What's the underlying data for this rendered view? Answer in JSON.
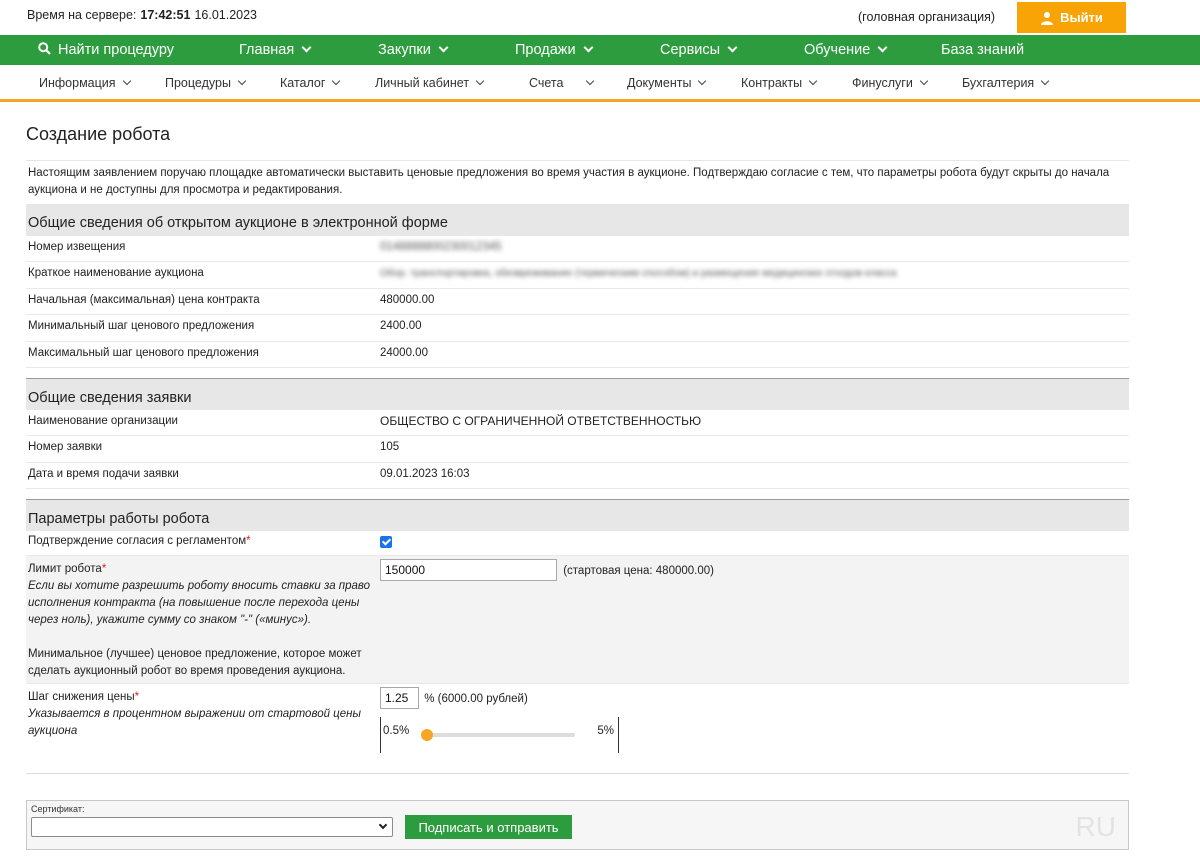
{
  "topbar": {
    "server_time_label": "Время на сервере:",
    "server_time": "17:42:51",
    "server_date": "16.01.2023",
    "org_note": "(головная организация)",
    "logout_label": "Выйти"
  },
  "colors": {
    "green": "#2d9c3f",
    "orange": "#f8a407",
    "accent_line": "#f5a623"
  },
  "main_nav": {
    "search_label": "Найти процедуру",
    "items": [
      {
        "label": "Главная",
        "dropdown": true
      },
      {
        "label": "Закупки",
        "dropdown": true
      },
      {
        "label": "Продажи",
        "dropdown": true
      },
      {
        "label": "Сервисы",
        "dropdown": true
      },
      {
        "label": "Обучение",
        "dropdown": true
      },
      {
        "label": "База знаний",
        "dropdown": false
      }
    ]
  },
  "sub_nav": {
    "items": [
      {
        "label": "Информация"
      },
      {
        "label": "Процедуры"
      },
      {
        "label": "Каталог"
      },
      {
        "label": "Личный кабинет"
      },
      {
        "label": "Счета"
      },
      {
        "label": "Документы"
      },
      {
        "label": "Контракты"
      },
      {
        "label": "Финуслуги"
      },
      {
        "label": "Бухгалтерия"
      }
    ]
  },
  "page": {
    "title": "Создание робота",
    "intro": "Настоящим заявлением поручаю площадке автоматически выставить ценовые предложения во время участия в аукционе. Подтверждаю согласие с тем, что параметры робота будут скрыты до начала аукциона и не доступны для просмотра и редактирования."
  },
  "auction": {
    "heading": "Общие сведения об открытом аукционе в электронной форме",
    "notice_label": "Номер извещения",
    "notice_value": "0148888800230012345",
    "short_name_label": "Краткое наименование аукциона",
    "short_name_value": "Обор. транспортировка, обезвреживание (термическим способом) и размещение медицинских отходов класса",
    "start_price_label": "Начальная (максимальная) цена контракта",
    "start_price_value": "480000.00",
    "min_step_label": "Минимальный шаг ценового предложения",
    "min_step_value": "2400.00",
    "max_step_label": "Максимальный шаг ценового предложения",
    "max_step_value": "24000.00"
  },
  "application": {
    "heading": "Общие сведения заявки",
    "org_label": "Наименование организации",
    "org_value": "ОБЩЕСТВО С ОГРАНИЧЕННОЙ ОТВЕТСТВЕННОСТЬЮ",
    "number_label": "Номер заявки",
    "number_value": "105",
    "date_label": "Дата и время подачи заявки",
    "date_value": "09.01.2023 16:03"
  },
  "robot": {
    "heading": "Параметры работы робота",
    "consent_label": "Подтверждение согласия с регламентом",
    "consent_checked": true,
    "limit_label": "Лимит робота",
    "limit_hint": "Если вы хотите разрешить роботу вносить ставки за право исполнения контракта (на повышение после перехода цены через ноль), укажите сумму со знаком \"-\" («минус»).",
    "limit_note": "Минимальное (лучшее) ценовое предложение, которое может сделать аукционный робот во время проведения аукциона.",
    "limit_value": "150000",
    "limit_start_note": "(стартовая цена: 480000.00)",
    "step_label": "Шаг снижения цены",
    "step_hint": "Указывается в процентном выражении от стартовой цены аукциона",
    "step_value": "1.25",
    "step_note": "% (6000.00 рублей)",
    "slider_min_label": "0.5%",
    "slider_max_label": "5%",
    "slider_min": 0.5,
    "slider_max": 5,
    "slider_value": 0.5,
    "required_mark": "*"
  },
  "sign": {
    "cert_label": "Сертификат:",
    "cert_value": "",
    "submit_label": "Подписать и отправить",
    "watermark": "RU"
  }
}
